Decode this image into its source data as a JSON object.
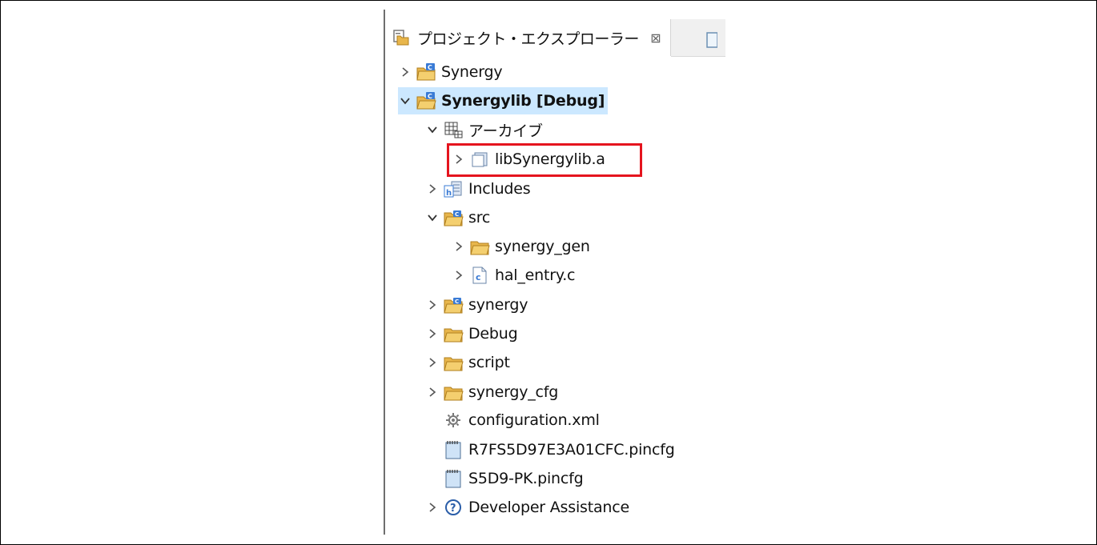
{
  "view": {
    "tab_title": "プロジェクト・エクスプローラー",
    "close_glyph": "⊠"
  },
  "tree": [
    {
      "label": "Synergy",
      "expanded": false,
      "icon": "c-project-icon",
      "depth": 0
    },
    {
      "label": "Synergylib [Debug]",
      "expanded": true,
      "icon": "c-project-open-icon",
      "depth": 0,
      "selected": true
    },
    {
      "label": "アーカイブ",
      "expanded": true,
      "icon": "archives-icon",
      "depth": 1
    },
    {
      "label": "libSynergylib.a",
      "expanded": false,
      "icon": "library-file-icon",
      "depth": 2,
      "highlighted": true
    },
    {
      "label": "Includes",
      "expanded": false,
      "icon": "includes-icon",
      "depth": 1
    },
    {
      "label": "src",
      "expanded": true,
      "icon": "source-folder-icon",
      "depth": 1
    },
    {
      "label": "synergy_gen",
      "expanded": false,
      "icon": "folder-icon",
      "depth": 2
    },
    {
      "label": "hal_entry.c",
      "expanded": false,
      "icon": "c-file-icon",
      "depth": 2
    },
    {
      "label": "synergy",
      "expanded": false,
      "icon": "source-folder-icon",
      "depth": 1
    },
    {
      "label": "Debug",
      "expanded": false,
      "icon": "folder-icon",
      "depth": 1
    },
    {
      "label": "script",
      "expanded": false,
      "icon": "folder-icon",
      "depth": 1
    },
    {
      "label": "synergy_cfg",
      "expanded": false,
      "icon": "folder-icon",
      "depth": 1
    },
    {
      "label": "configuration.xml",
      "icon": "gear-icon",
      "depth": 1
    },
    {
      "label": "R7FS5D97E3A01CFC.pincfg",
      "icon": "notepad-icon",
      "depth": 1
    },
    {
      "label": "S5D9-PK.pincfg",
      "icon": "notepad-icon",
      "depth": 1
    },
    {
      "label": "Developer Assistance",
      "expanded": false,
      "icon": "help-icon",
      "depth": 1
    }
  ],
  "colors": {
    "selection": "#cce8ff",
    "highlight_border": "#e5141e",
    "folder": "#e8b64c",
    "project_blue": "#3a7bd5"
  }
}
